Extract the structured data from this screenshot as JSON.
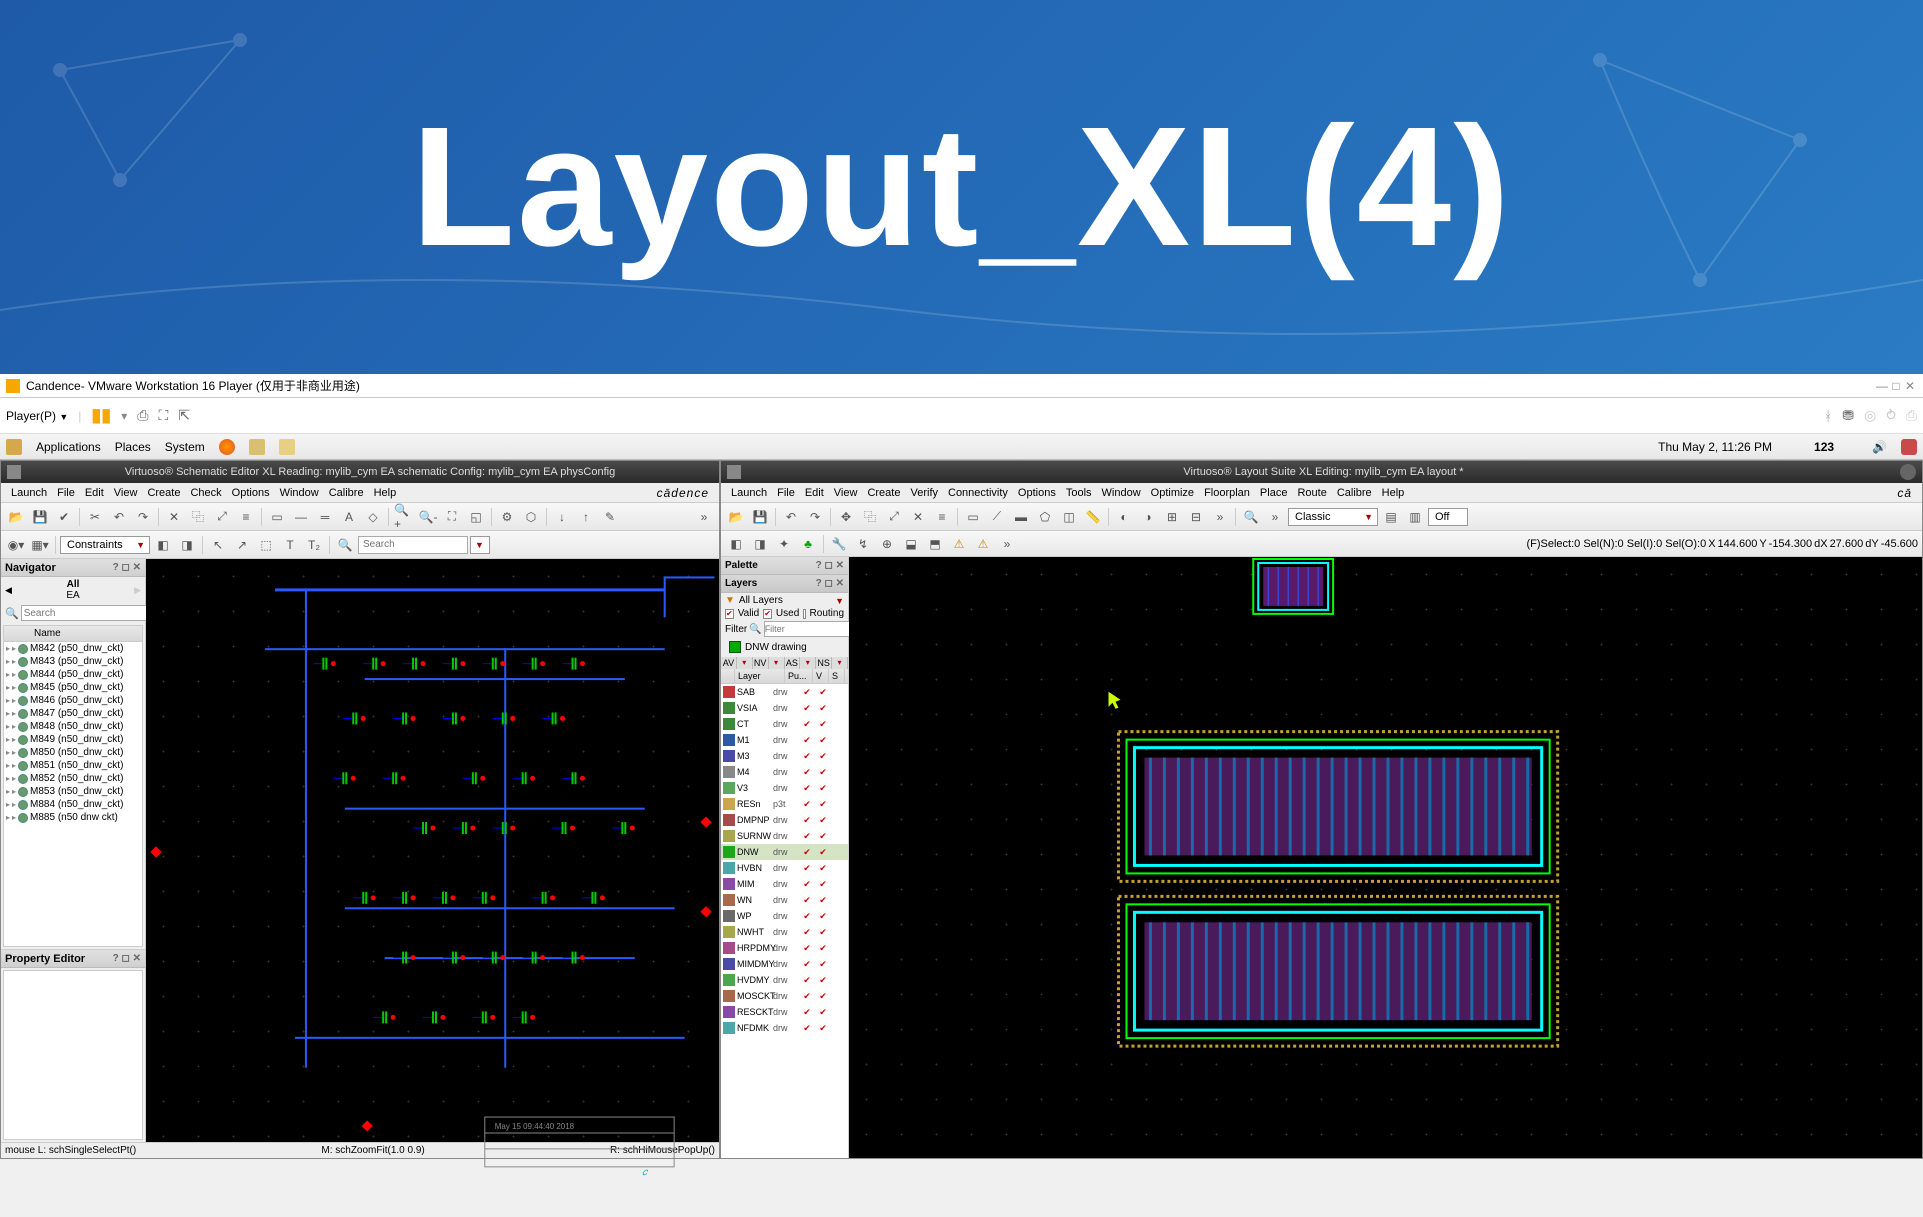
{
  "banner": {
    "title": "Layout_XL(4)"
  },
  "vm": {
    "title": "Candence- VMware Workstation 16 Player (仅用于非商业用途)",
    "player_menu": "Player(P)"
  },
  "gnome": {
    "menus": [
      "Applications",
      "Places",
      "System"
    ],
    "clock": "Thu May  2, 11:26 PM",
    "battery": "123"
  },
  "schematic_window": {
    "title": "Virtuoso® Schematic Editor XL Reading: mylib_cym EA schematic  Config: mylib_cym EA physConfig",
    "menus": [
      "Launch",
      "File",
      "Edit",
      "View",
      "Create",
      "Check",
      "Options",
      "Window",
      "Calibre",
      "Help"
    ],
    "brand": "cādence",
    "constraints_drop": "Constraints",
    "search_ph": "Search",
    "navigator": {
      "title": "Navigator",
      "all_label": "All",
      "context": "EA",
      "name_col": "Name",
      "items": [
        "M842 (p50_dnw_ckt)",
        "M843 (p50_dnw_ckt)",
        "M844 (p50_dnw_ckt)",
        "M845 (p50_dnw_ckt)",
        "M846 (p50_dnw_ckt)",
        "M847 (p50_dnw_ckt)",
        "M848 (n50_dnw_ckt)",
        "M849 (n50_dnw_ckt)",
        "M850 (n50_dnw_ckt)",
        "M851 (n50_dnw_ckt)",
        "M852 (n50_dnw_ckt)",
        "M853 (n50_dnw_ckt)",
        "M884 (n50_dnw_ckt)",
        "M885 (n50  dnw  ckt)"
      ]
    },
    "prop_editor": "Property Editor",
    "status": {
      "left": "mouse L: schSingleSelectPt()",
      "mid": "M: schZoomFit(1.0 0.9)",
      "right": "R: schHiMousePopUp()"
    },
    "titleblock_date": "May 15 09:44:40 2018"
  },
  "layout_window": {
    "title": "Virtuoso® Layout Suite XL Editing: mylib_cym EA layout *",
    "menus": [
      "Launch",
      "File",
      "Edit",
      "View",
      "Create",
      "Verify",
      "Connectivity",
      "Options",
      "Tools",
      "Window",
      "Optimize",
      "Floorplan",
      "Place",
      "Route",
      "Calibre",
      "Help"
    ],
    "brand": "cā",
    "classic": "Classic",
    "off": "Off",
    "sel_info": "(F)Select:0  Sel(N):0  Sel(I):0  Sel(O):0",
    "coords": {
      "X": "144.600",
      "Y": "-154.300",
      "dX": "27.600",
      "dY": "-45.600"
    },
    "palette": {
      "title": "Palette",
      "layers_title": "Layers",
      "all_layers": "All Layers",
      "valid": "Valid",
      "used": "Used",
      "routing": "Routing",
      "filter_label": "Filter",
      "filter_ph": "Filter",
      "current_layer": "DNW drawing",
      "avnv": [
        "AV",
        "NV",
        "AS",
        "NS"
      ],
      "cols": [
        "Layer",
        "Pu...",
        "V",
        "S"
      ],
      "rows": [
        {
          "name": "SAB",
          "pu": "drw",
          "sw": "#c23a3a"
        },
        {
          "name": "VSIA",
          "pu": "drw",
          "sw": "#3a8a3a"
        },
        {
          "name": "CT",
          "pu": "drw",
          "sw": "#3a8a3a"
        },
        {
          "name": "M1",
          "pu": "drw",
          "sw": "#2a5aa8"
        },
        {
          "name": "M3",
          "pu": "drw",
          "sw": "#4a4aa8"
        },
        {
          "name": "M4",
          "pu": "drw",
          "sw": "#888888"
        },
        {
          "name": "V3",
          "pu": "drw",
          "sw": "#5aa85a"
        },
        {
          "name": "RESn",
          "pu": "p3t",
          "sw": "#c8a84a"
        },
        {
          "name": "DMPNP",
          "pu": "drw",
          "sw": "#a84a4a"
        },
        {
          "name": "SURNW",
          "pu": "drw",
          "sw": "#a8a84a"
        },
        {
          "name": "DNW",
          "pu": "drw",
          "sw": "#1aa81a"
        },
        {
          "name": "HVBN",
          "pu": "drw",
          "sw": "#4aa8a8"
        },
        {
          "name": "MIM",
          "pu": "drw",
          "sw": "#8a4aa8"
        },
        {
          "name": "WN",
          "pu": "drw",
          "sw": "#a86a4a"
        },
        {
          "name": "WP",
          "pu": "drw",
          "sw": "#6a6a6a"
        },
        {
          "name": "NWHT",
          "pu": "drw",
          "sw": "#a8a84a"
        },
        {
          "name": "HRPDMY",
          "pu": "drw",
          "sw": "#a84a8a"
        },
        {
          "name": "MIMDMY",
          "pu": "drw",
          "sw": "#4a4aa8"
        },
        {
          "name": "HVDMY",
          "pu": "drw",
          "sw": "#4aa84a"
        },
        {
          "name": "MOSCKT",
          "pu": "drw",
          "sw": "#a8684a"
        },
        {
          "name": "RESCKT",
          "pu": "drw",
          "sw": "#884aa8"
        },
        {
          "name": "NFDMK",
          "pu": "drw",
          "sw": "#4aa8a8"
        }
      ]
    }
  }
}
